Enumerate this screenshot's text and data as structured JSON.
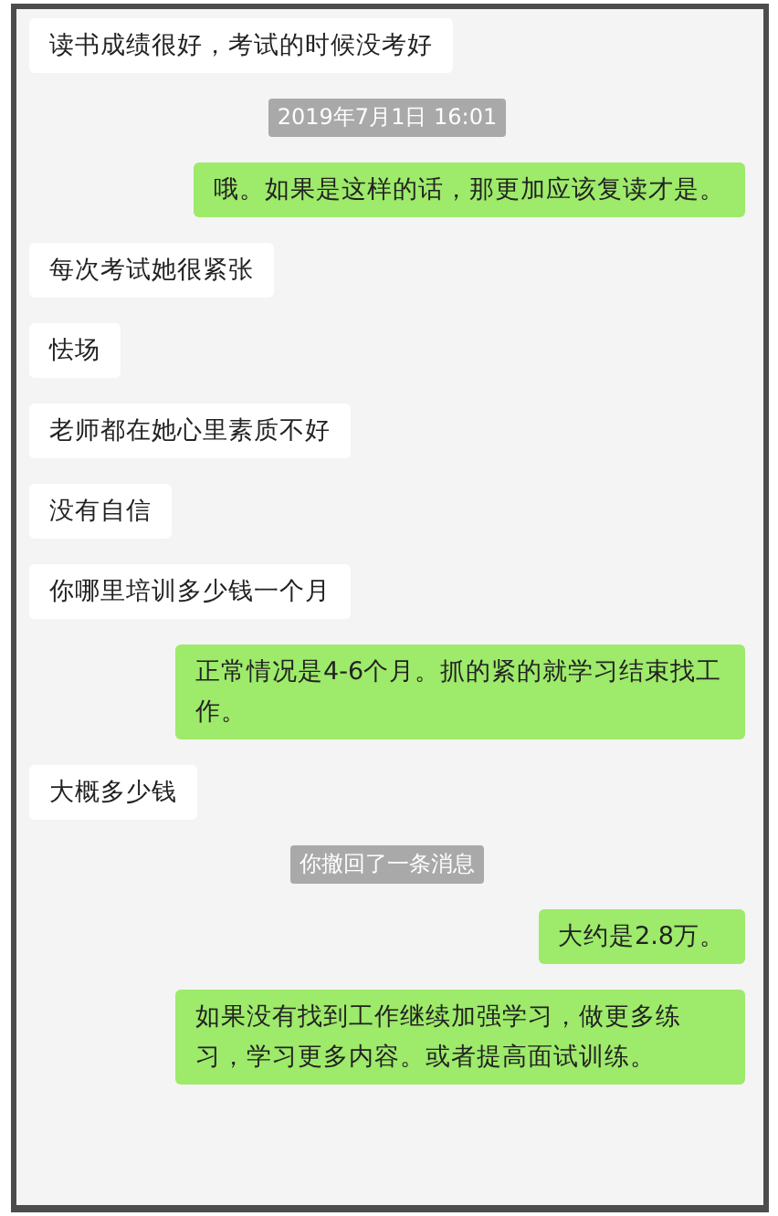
{
  "messages": [
    {
      "kind": "received",
      "text": "读书成绩很好，考试的时候没考好"
    },
    {
      "kind": "time",
      "text": "2019年7月1日 16:01"
    },
    {
      "kind": "sent",
      "text": "哦。如果是这样的话，那更加应该复读才是。"
    },
    {
      "kind": "received",
      "text": "每次考试她很紧张"
    },
    {
      "kind": "received",
      "text": "怯场"
    },
    {
      "kind": "received",
      "text": "老师都在她心里素质不好"
    },
    {
      "kind": "received",
      "text": "没有自信"
    },
    {
      "kind": "received",
      "text": "你哪里培训多少钱一个月"
    },
    {
      "kind": "sent",
      "text": "正常情况是4-6个月。抓的紧的就学习结束找工作。"
    },
    {
      "kind": "received",
      "text": "大概多少钱"
    },
    {
      "kind": "system",
      "text": "你撤回了一条消息"
    },
    {
      "kind": "sent",
      "text": "大约是2.8万。"
    },
    {
      "kind": "sent",
      "text": "如果没有找到工作继续加强学习，做更多练习，学习更多内容。或者提高面试训练。"
    }
  ]
}
